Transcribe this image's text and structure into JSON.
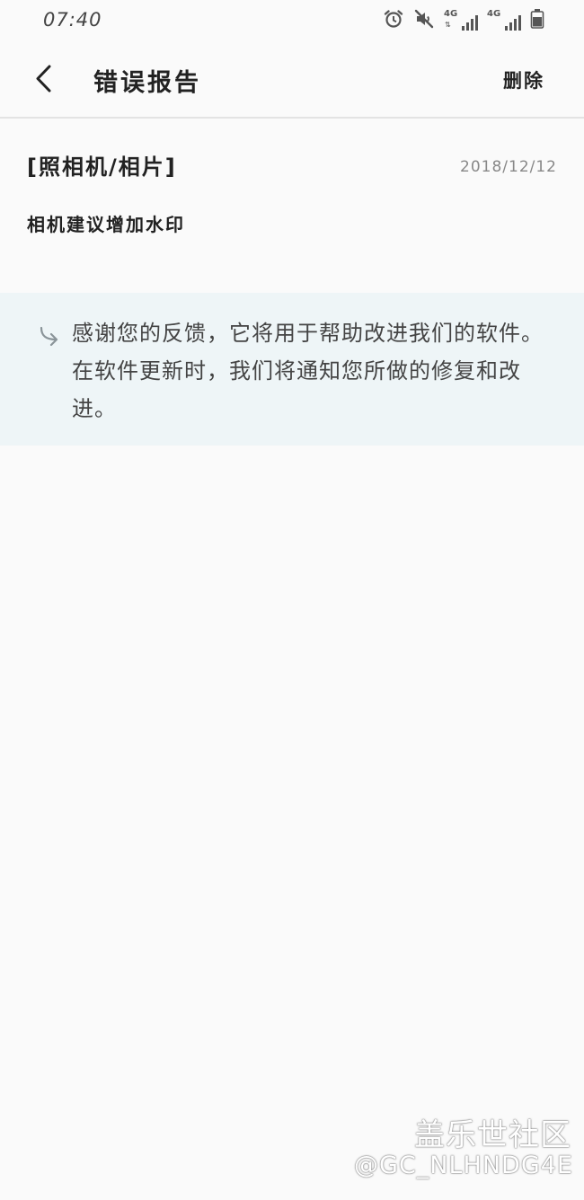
{
  "status_bar": {
    "time": "07:40",
    "network_1": "4G",
    "network_2": "4G",
    "icons": [
      "alarm-icon",
      "mute-icon",
      "signal-icon",
      "signal-icon",
      "battery-icon"
    ]
  },
  "header": {
    "title": "错误报告",
    "delete_label": "删除",
    "back_icon": "chevron-left-icon"
  },
  "report": {
    "category": "[照相机/相片]",
    "date": "2018/12/12",
    "content": "相机建议增加水印"
  },
  "reply": {
    "icon": "reply-arrow-icon",
    "text": "感谢您的反馈，它将用于帮助改进我们的软件。在软件更新时，我们将通知您所做的修复和改进。"
  },
  "watermark": {
    "community": "盖乐世社区",
    "handle": "@GC_NLHNDG4E"
  },
  "colors": {
    "background": "#fafafa",
    "reply_background": "#eef5f7",
    "divider": "#e3e3e3",
    "date_text": "#888888"
  }
}
